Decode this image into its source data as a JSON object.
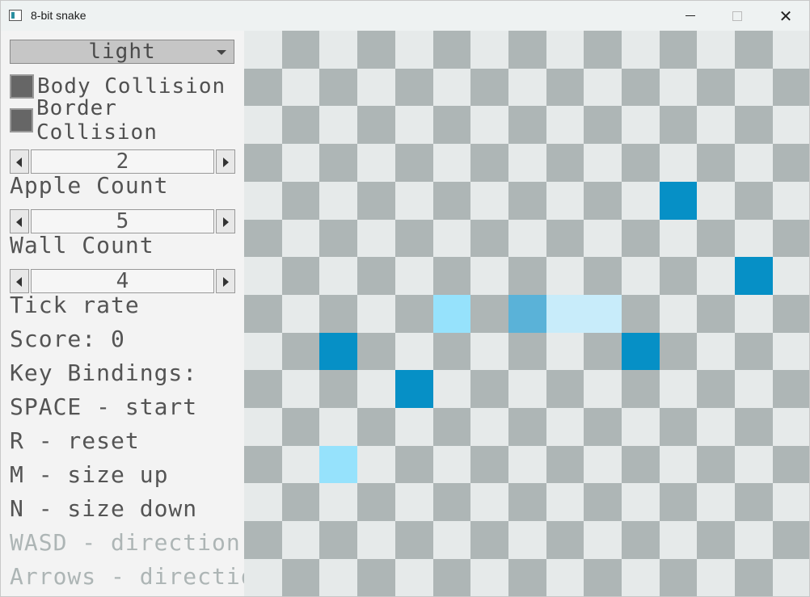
{
  "window": {
    "title": "8-bit snake",
    "minimize_icon": "minimize-icon",
    "maximize_icon": "maximize-icon",
    "close_glyph": "✕"
  },
  "sidebar": {
    "theme_select": {
      "selected": "light"
    },
    "body_collision": {
      "label": "Body Collision",
      "checked": true
    },
    "border_collision": {
      "label": "Border Collision",
      "checked": true
    },
    "apple_count": {
      "value": "2",
      "label": "Apple Count"
    },
    "wall_count": {
      "value": "5",
      "label": "Wall Count"
    },
    "tick_rate": {
      "value": "4",
      "label": "Tick rate"
    },
    "score": "Score: 0",
    "key_bindings": {
      "heading": "Key Bindings:",
      "space": "SPACE - start",
      "reset": "R - reset",
      "size_up": "M - size up",
      "size_down": "N - size down",
      "wasd": "WASD - direction",
      "arrows": "Arrows - direction"
    }
  },
  "board": {
    "columns": 15,
    "rows": 15,
    "colors": {
      "light_cell": "#e6eaea",
      "dark_cell": "#aeb6b6",
      "wall": "#0690c6",
      "apple": "#96e2fc",
      "snake_head": "#5ab2d8",
      "snake_body": "#c8ecfa"
    },
    "walls": [
      [
        11,
        4
      ],
      [
        13,
        6
      ],
      [
        2,
        8
      ],
      [
        10,
        8
      ],
      [
        4,
        9
      ]
    ],
    "apples": [
      [
        5,
        7
      ],
      [
        2,
        11
      ]
    ],
    "snake": {
      "head": [
        7,
        7
      ],
      "body": [
        [
          8,
          7
        ],
        [
          9,
          7
        ]
      ]
    }
  }
}
